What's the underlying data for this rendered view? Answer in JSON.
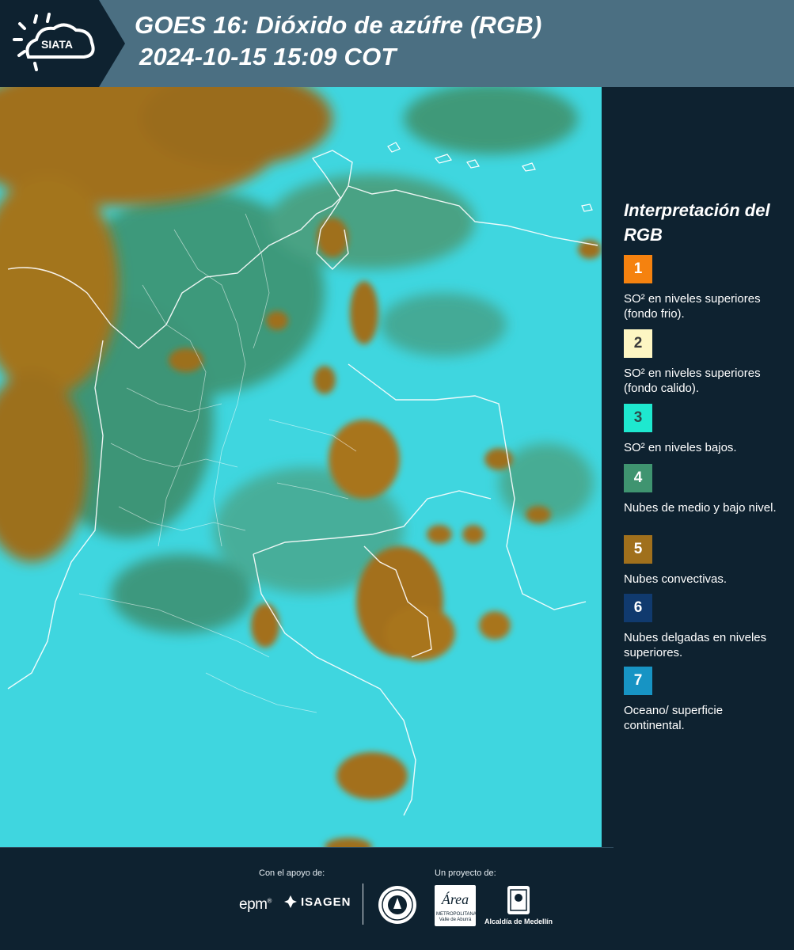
{
  "header": {
    "logo_text": "SIATA",
    "title_line1": "GOES 16: Dióxido de azúfre (RGB)",
    "title_line2": "2024-10-15 15:09 COT",
    "background_color": "#4b6f82"
  },
  "legend": {
    "title": "Interpretación del RGB",
    "items": [
      {
        "number": "1",
        "label": "SO² en niveles superiores (fondo frio).",
        "color": "#f5820f",
        "text_color": "#ffffff"
      },
      {
        "number": "2",
        "label": "SO² en niveles superiores (fondo calido).",
        "color": "#fdf6c3",
        "text_color": "#3a3a3a"
      },
      {
        "number": "3",
        "label": "SO² en niveles bajos.",
        "color": "#1ee8cf",
        "text_color": "#2c4a4a"
      },
      {
        "number": "4",
        "label": "Nubes de medio y bajo nivel.",
        "color": "#3f9470",
        "text_color": "#ffffff"
      },
      {
        "number": "5",
        "label": "Nubes convectivas.",
        "color": "#a0701c",
        "text_color": "#ffffff"
      },
      {
        "number": "6",
        "label": "Nubes delgadas en niveles superiores.",
        "color": "#103a6e",
        "text_color": "#ffffff"
      },
      {
        "number": "7",
        "label": "Oceano/ superficie continental.",
        "color": "#1794c4",
        "text_color": "#ffffff"
      }
    ]
  },
  "footer": {
    "support_label": "Con el apoyo de:",
    "project_label": "Un proyecto de:",
    "epm": "epm",
    "isagen": "ISAGEN",
    "area_metropolitana": "METROPOLITANA Valle de Aburrá",
    "area_script": "Área",
    "alcaldia": "Alcaldía de Medellín"
  }
}
